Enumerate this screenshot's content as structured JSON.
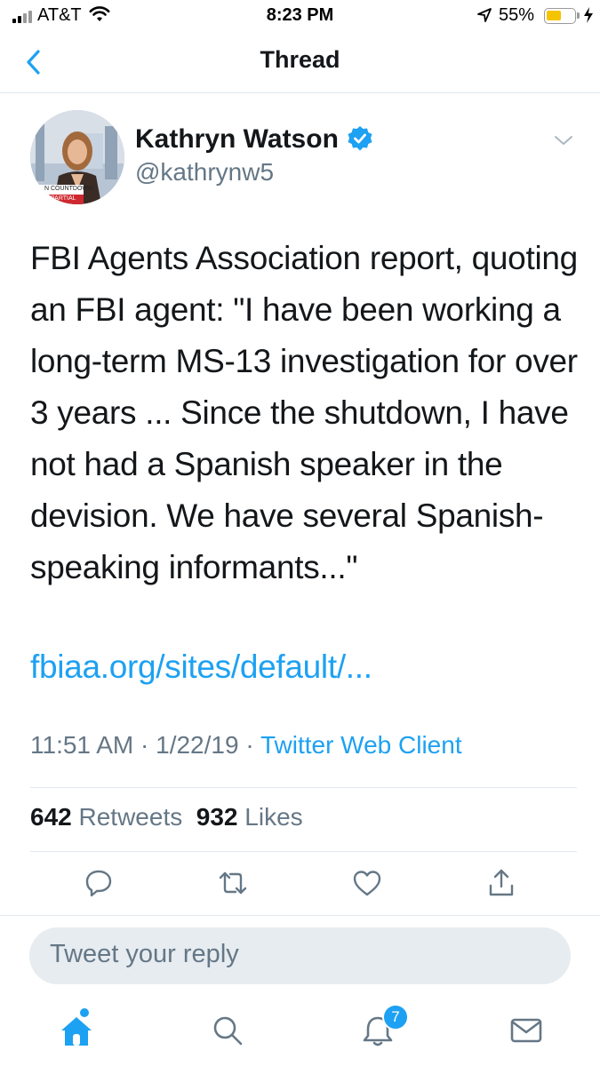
{
  "status_bar": {
    "carrier": "AT&T",
    "time": "8:23 PM",
    "battery_pct": "55%",
    "battery_level": 0.55,
    "battery_color": "#f5c400"
  },
  "nav": {
    "title": "Thread",
    "back_icon": "chevron-left-icon"
  },
  "tweet": {
    "author_name": "Kathryn Watson",
    "author_handle": "@kathrynw5",
    "verified": true,
    "avatar_caption": [
      "N COUNTDOWN",
      "D PARTIAL"
    ],
    "text": "FBI Agents Association report, quoting an FBI agent: \"I have been working a long-term MS-13 investigation for over 3 years ... Since the shutdown, I have not had a Spanish speaker in the devision. We have several Spanish-speaking informants...\"",
    "link": "fbiaa.org/sites/default/...",
    "time": "11:51 AM",
    "date": "1/22/19",
    "client": "Twitter Web Client",
    "retweets_count": "642",
    "retweets_label": "Retweets",
    "likes_count": "932",
    "likes_label": "Likes"
  },
  "actions": [
    "reply-icon",
    "retweet-icon",
    "like-icon",
    "share-icon"
  ],
  "reply_box": {
    "placeholder": "Tweet your reply"
  },
  "tab_bar": {
    "items": [
      "home-icon",
      "search-icon",
      "notifications-icon",
      "messages-icon"
    ],
    "notifications_badge": "7"
  },
  "colors": {
    "accent": "#1da1f2",
    "secondary_text": "#657786",
    "divider": "#e1e8ed"
  }
}
